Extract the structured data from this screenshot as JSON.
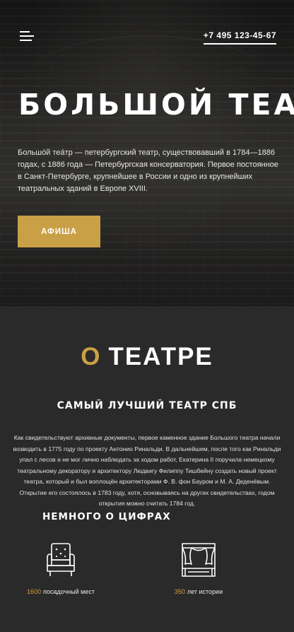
{
  "header": {
    "phone": "+7 495 123-45-67"
  },
  "hero": {
    "title": "БОЛЬШОЙ ТЕАТР",
    "description": "Большо́й теа́тр — петербургский театр, существовавший в 1784—1886 годах, с 1886 года — Петербургская консерватория. Первое постоянное в Санкт-Петербурге, крупнейшее в России и одно из крупнейших театральных зданий в Европе XVIII.",
    "button_label": "АФИША"
  },
  "about": {
    "title_accent": "О",
    "title_rest": "ТЕАТРЕ",
    "subtitle": "САМЫЙ ЛУЧШИЙ ТЕАТР СПБ",
    "text": "Как свидетельствуют архивные документы, первое каменное здание Большого театра начали возводить в 1775 году по проекту Антонио Ринальди. В дальнейшем, после того как Ринальди упал с лесов и не мог лично наблюдать за ходом работ, Екатерина II поручила немецкому театральному декоратору и архитектору Людвигу Филиппу Тишбейну создать новый проект театра, который и был воплощён архитекторами Ф. В. фон Бауром и М. А. Деденёвым. Открытие его состоялось в 1783 году, хотя, основываясь на других свидетельствах, годом открытия можно считать 1784 год."
  },
  "numbers": {
    "title": "НЕМНОГО О ЦИФРАХ",
    "stats": [
      {
        "value": "1600",
        "label": "посадочный мест",
        "icon": "armchair-icon"
      },
      {
        "value": "350",
        "label": "лет истории",
        "icon": "stage-curtain-icon"
      }
    ]
  },
  "colors": {
    "accent": "#c9a045",
    "background": "#2b2a2a"
  }
}
